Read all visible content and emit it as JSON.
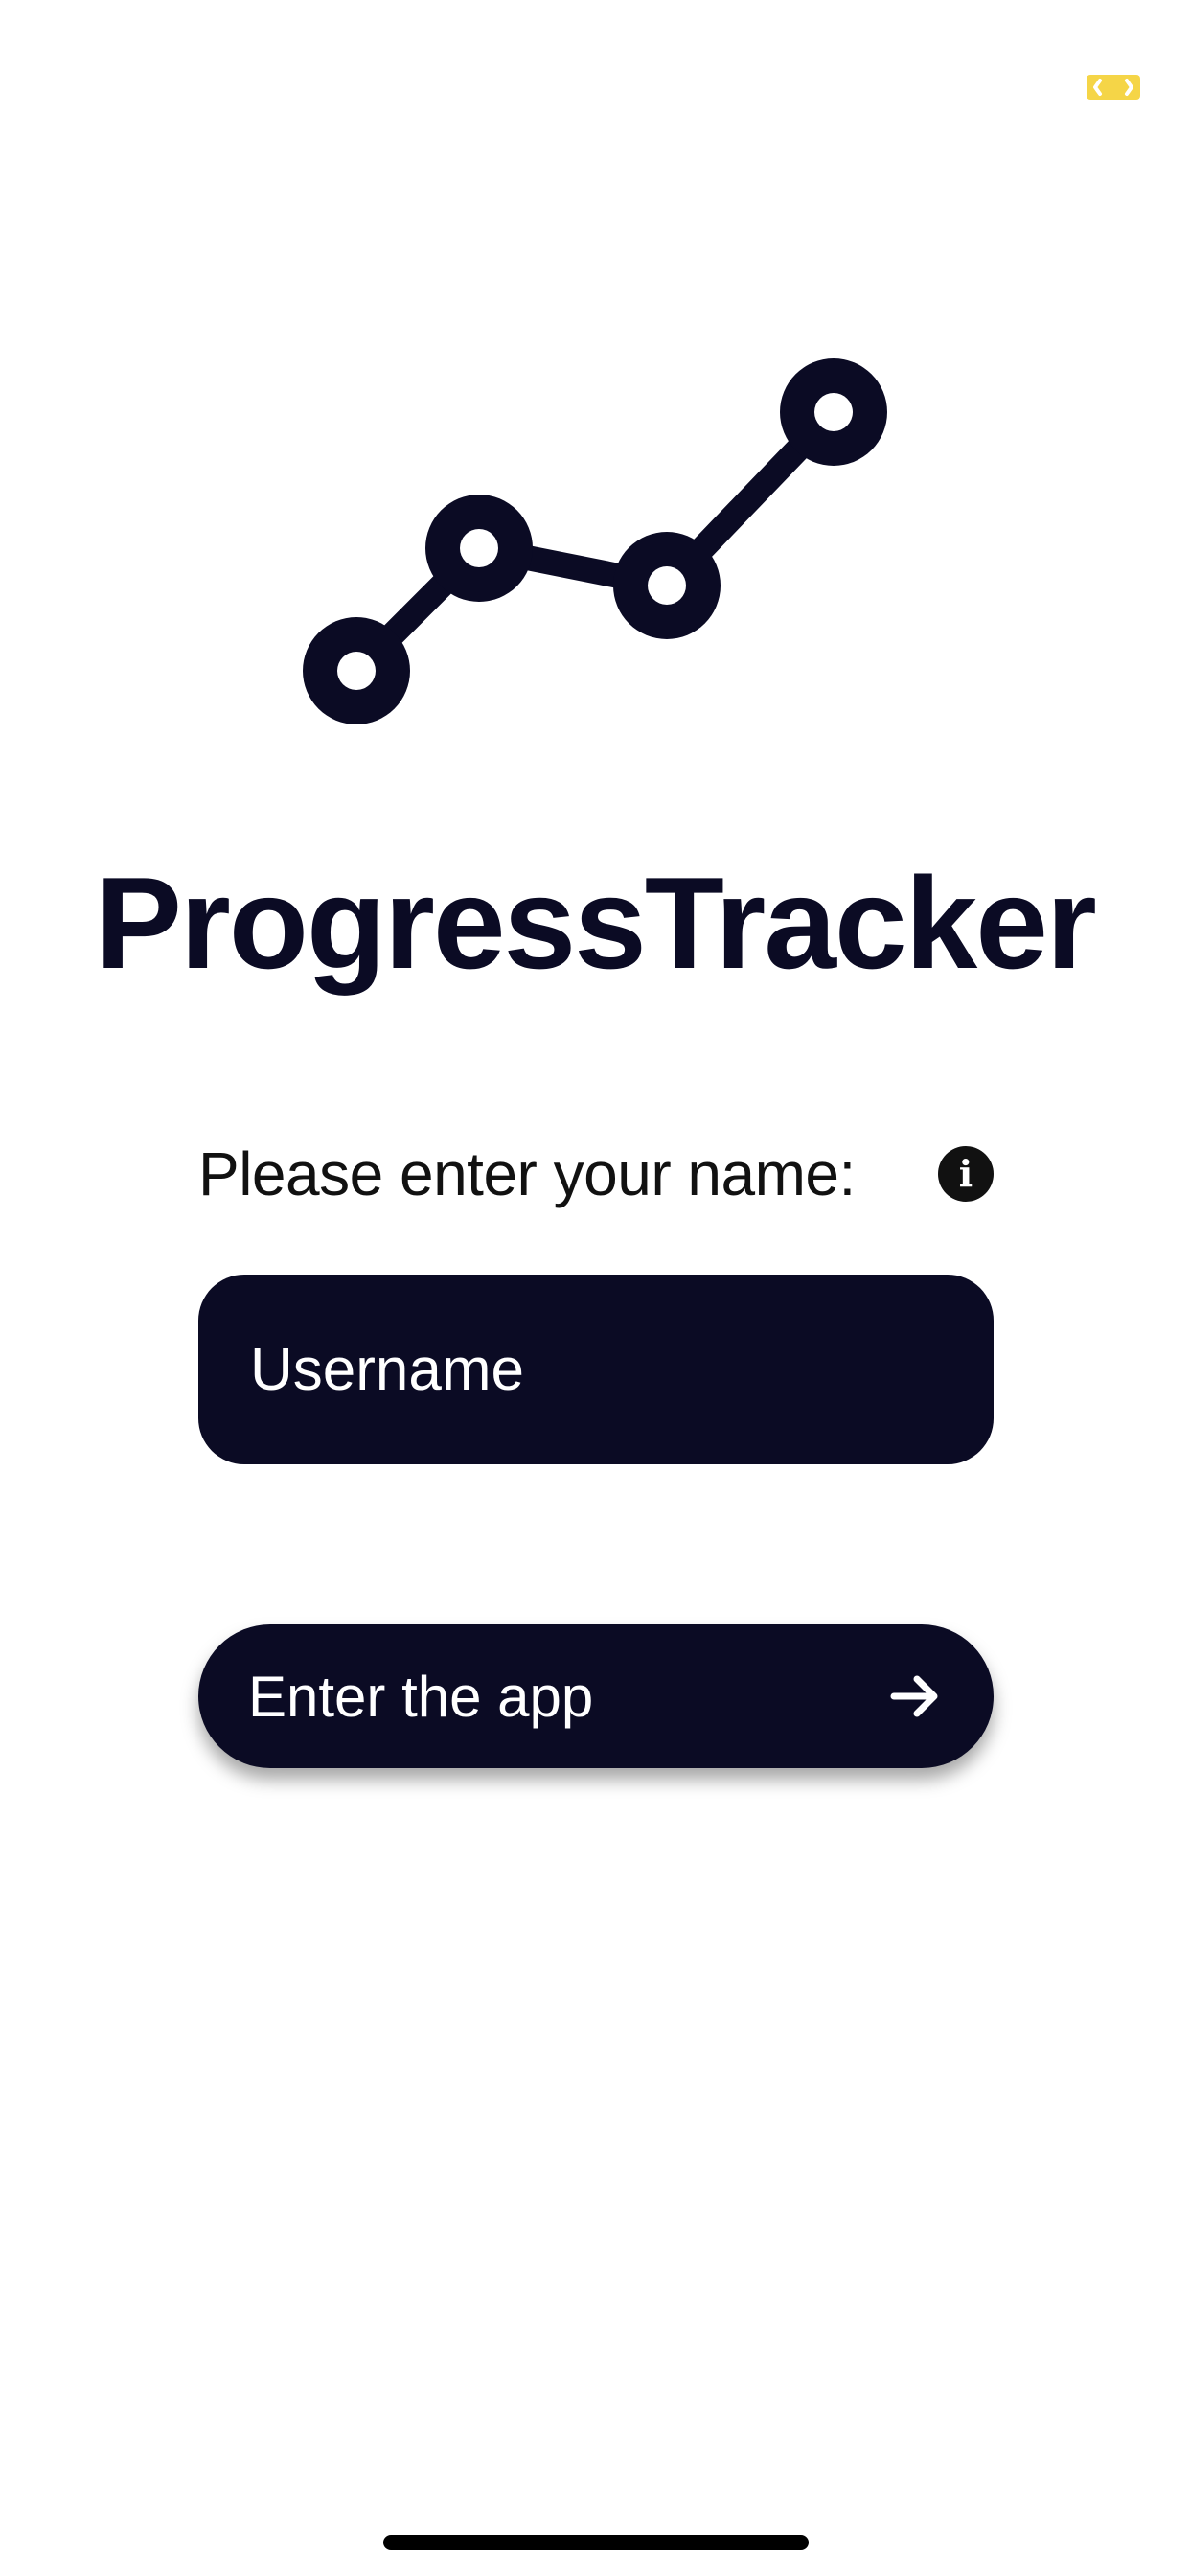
{
  "colors": {
    "primary": "#0b0b24",
    "background": "#ffffff",
    "on_primary": "#ffffff",
    "indicator_accent": "#f5d547"
  },
  "status_indicator": {
    "icon": "bracket-indicator-icon"
  },
  "logo": {
    "icon": "progress-line-graph-icon"
  },
  "app": {
    "title": "ProgressTracker"
  },
  "form": {
    "prompt_label": "Please enter your name:",
    "info_icon": "info-icon",
    "info_glyph": "i",
    "username_placeholder": "Username",
    "username_value": ""
  },
  "actions": {
    "enter_label": "Enter the app",
    "enter_icon": "arrow-right-icon"
  }
}
